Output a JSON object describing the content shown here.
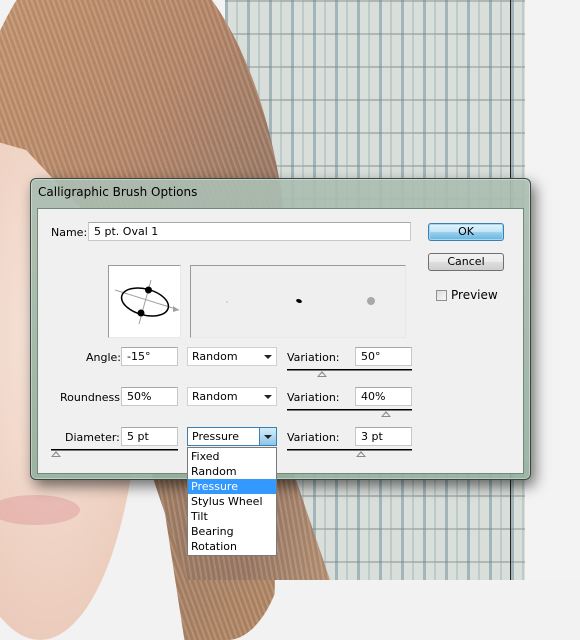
{
  "dialog": {
    "title": "Calligraphic Brush Options",
    "name_label": "Name:",
    "name_value": "5 pt. Oval 1",
    "ok_label": "OK",
    "cancel_label": "Cancel",
    "preview_label": "Preview",
    "preview_checked": false,
    "rows": [
      {
        "label": "Angle:",
        "value": "-15°",
        "mode": "Random",
        "variation_label": "Variation:",
        "variation_value": "50°",
        "value_slider_fraction": null,
        "variation_slider_fraction": 0.28
      },
      {
        "label": "Roundness:",
        "value": "50%",
        "mode": "Random",
        "variation_label": "Variation:",
        "variation_value": "40%",
        "value_slider_fraction": null,
        "variation_slider_fraction": 0.8
      },
      {
        "label": "Diameter:",
        "value": "5 pt",
        "mode": "Pressure",
        "variation_label": "Variation:",
        "variation_value": "3 pt",
        "value_slider_fraction": 0.0,
        "variation_slider_fraction": 0.6
      }
    ],
    "dropdown": {
      "open_for": "Diameter",
      "options": [
        "Fixed",
        "Random",
        "Pressure",
        "Stylus Wheel",
        "Tilt",
        "Bearing",
        "Rotation"
      ],
      "selected": "Pressure"
    }
  }
}
